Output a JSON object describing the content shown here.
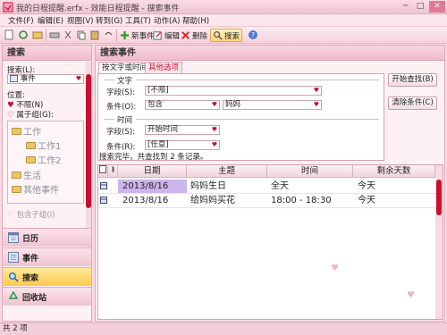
{
  "window": {
    "title": "我的日程提醒.erfx - 效能日程提醒 - 搜索事件",
    "minimize": "─",
    "maximize": "□",
    "close": "✕"
  },
  "menu": [
    "文件(F)",
    "编辑(E)",
    "视图(V)",
    "转到(G)",
    "工具(T)",
    "动作(A)",
    "帮助(H)"
  ],
  "toolbar": {
    "new_event": "新事件",
    "edit": "编辑",
    "delete": "删除",
    "search": "搜索"
  },
  "left": {
    "title": "搜索",
    "search_label": "搜索(L):",
    "search_value": "事件",
    "position_label": "位置:",
    "opt_unlimited": "不限(N)",
    "opt_group": "属于组(G):",
    "tree": [
      {
        "label": "工作",
        "level": 0
      },
      {
        "label": "工作1",
        "level": 1
      },
      {
        "label": "工作2",
        "level": 1
      },
      {
        "label": "生活",
        "level": 0
      },
      {
        "label": "其他事件",
        "level": 0
      }
    ],
    "include_subgroups": "包含子组(I)",
    "nav": [
      {
        "label": "日历",
        "icon": "calendar-icon",
        "active": false
      },
      {
        "label": "事件",
        "icon": "event-icon",
        "active": false
      },
      {
        "label": "搜索",
        "icon": "search-icon",
        "active": true
      },
      {
        "label": "回收站",
        "icon": "recycle-icon",
        "active": false
      }
    ]
  },
  "right": {
    "title": "搜索事件",
    "tabs": [
      "按文字或时间",
      "其他选项"
    ],
    "group_text": "文字",
    "field_label": "字段(S):",
    "field_value": "[不限]",
    "cond_label": "条件(O):",
    "cond_value": "包含",
    "cond_text": "妈妈",
    "group_time": "时间",
    "time_field_label": "字段(S):",
    "time_field_value": "开始时间",
    "time_cond_label": "条件(R):",
    "time_cond_value": "[任意]",
    "btn_start": "开始查找(B)",
    "btn_clear": "清除条件(C)",
    "result_text": "搜索完毕，共查找到 2 条记录。",
    "columns": [
      "日期",
      "主题",
      "时间",
      "剩余天数"
    ],
    "rows": [
      {
        "date": "2013/8/16",
        "subject": "妈妈生日",
        "time": "全天",
        "remaining": "今天"
      },
      {
        "date": "2013/8/16",
        "subject": "给妈妈买花",
        "time": "18:00 - 18:30",
        "remaining": "今天"
      }
    ]
  },
  "status": "共 2 项"
}
